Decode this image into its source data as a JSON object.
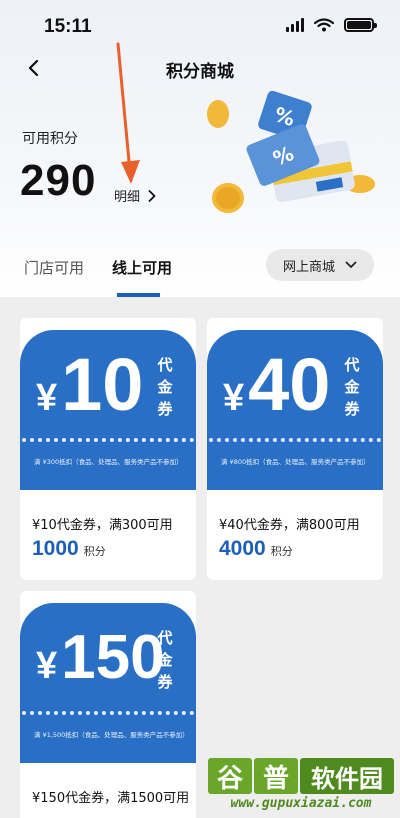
{
  "status_bar": {
    "time": "15:11"
  },
  "header": {
    "title": "积分商城"
  },
  "points": {
    "label": "可用积分",
    "value": "290",
    "detail_label": "明细"
  },
  "tabs": [
    {
      "label": "门店可用",
      "active": false
    },
    {
      "label": "线上可用",
      "active": true
    }
  ],
  "mall_filter": {
    "label": "网上商城"
  },
  "coupons": [
    {
      "currency": "¥",
      "amount": "10",
      "type_text": "代金券",
      "note": "满 ¥300抵扣（食品、处理品、服务类产品不参加）",
      "name": "¥10代金券，满300可用",
      "price": "1000",
      "price_unit": "积分"
    },
    {
      "currency": "¥",
      "amount": "40",
      "type_text": "代金券",
      "note": "满 ¥800抵扣（食品、处理品、服务类产品不参加）",
      "name": "¥40代金券，满800可用",
      "price": "4000",
      "price_unit": "积分"
    },
    {
      "currency": "¥",
      "amount": "150",
      "type_text": "代金券",
      "note": "满 ¥1,500抵扣（食品、处理品、服务类产品不参加）",
      "name": "¥150代金券，满1500可用"
    }
  ],
  "watermark": {
    "chars": [
      "谷",
      "普",
      "软件园"
    ],
    "url": "www.gupuxiazai.com"
  },
  "colors": {
    "accent": "#1d5fb8",
    "coupon": "#2a6fc6",
    "arrow": "#e8612a"
  }
}
